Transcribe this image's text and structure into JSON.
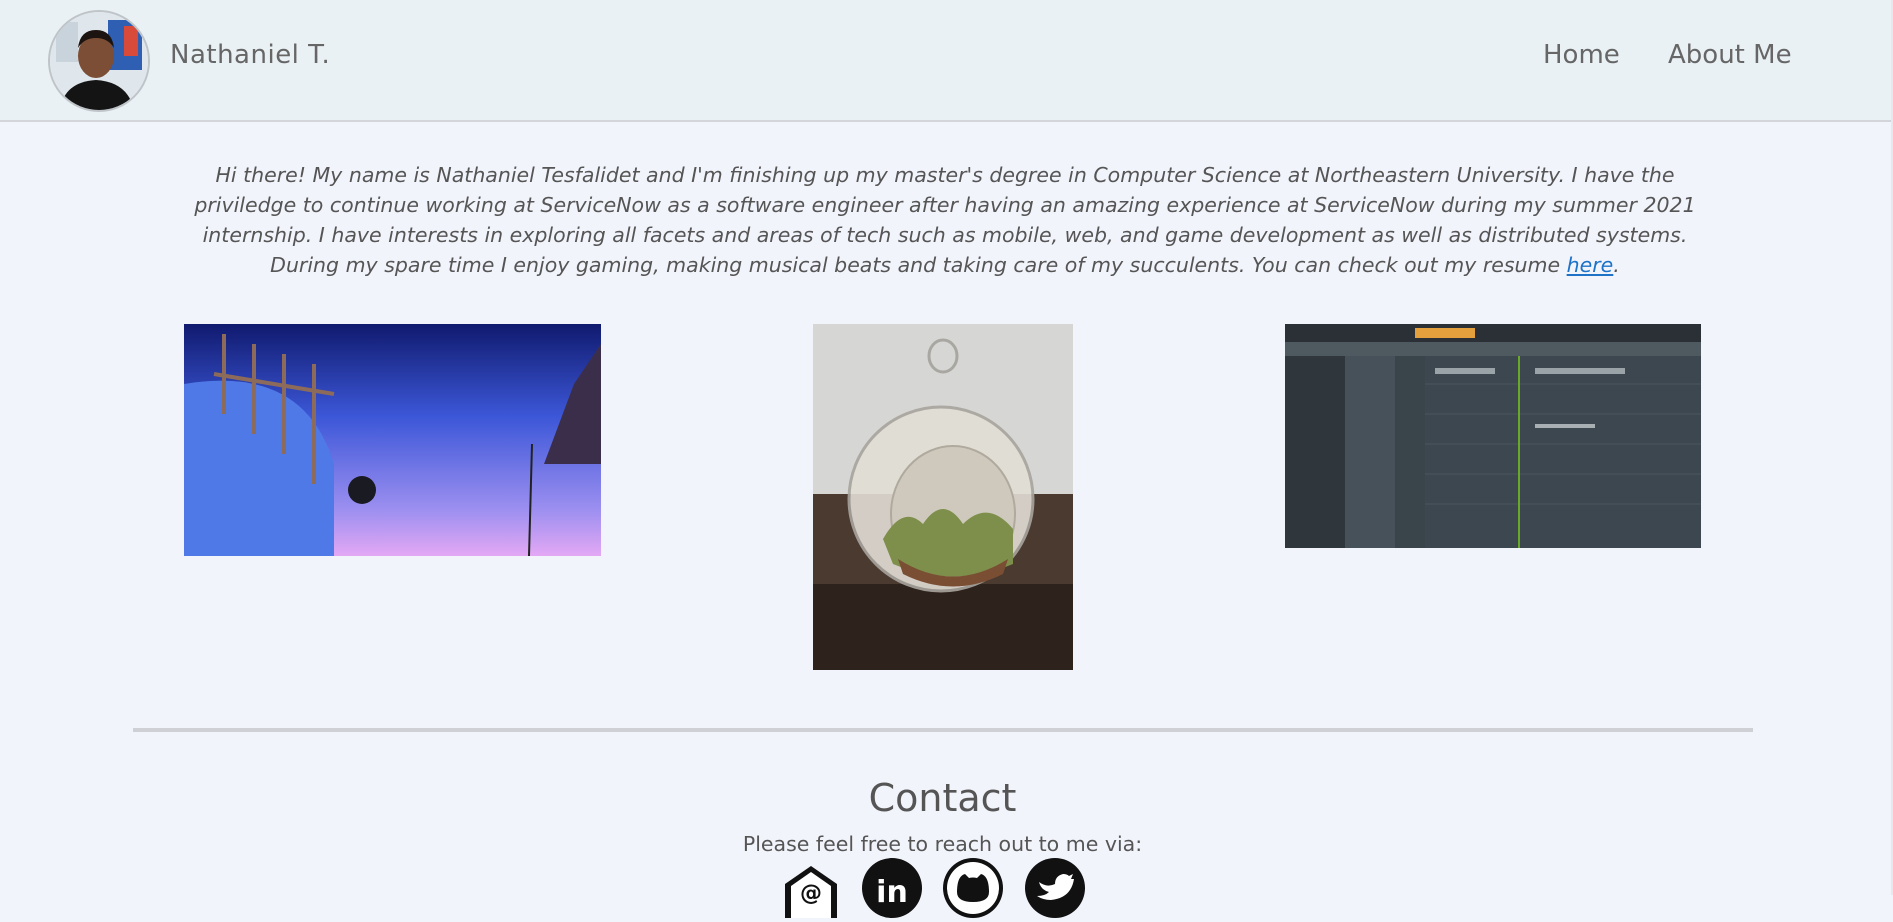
{
  "header": {
    "site_name": "Nathaniel T.",
    "nav": [
      {
        "label": "Home"
      },
      {
        "label": "About Me"
      }
    ]
  },
  "intro": {
    "text": "Hi there! My name is Nathaniel Tesfalidet and I'm finishing up my master's degree in Computer Science at Northeastern University. I have the priviledge to continue working at ServiceNow as a software engineer after having an amazing experience at ServiceNow during my summer 2021 internship. I have interests in exploring all facets and areas of tech such as mobile, web, and game development as well as distributed systems. During my spare time I enjoy gaming, making musical beats and taking care of my succulents. You can check out my resume ",
    "link_label": "here",
    "end": "."
  },
  "contact": {
    "title": "Contact",
    "subtitle": "Please feel free to reach out to me via:"
  },
  "colors": {
    "background": "#f2f4fc",
    "header_bg": "#e9f1f5",
    "link": "#1e73c7",
    "text": "#555555"
  },
  "icons": [
    "email-icon",
    "linkedin-icon",
    "github-icon",
    "twitter-icon"
  ]
}
